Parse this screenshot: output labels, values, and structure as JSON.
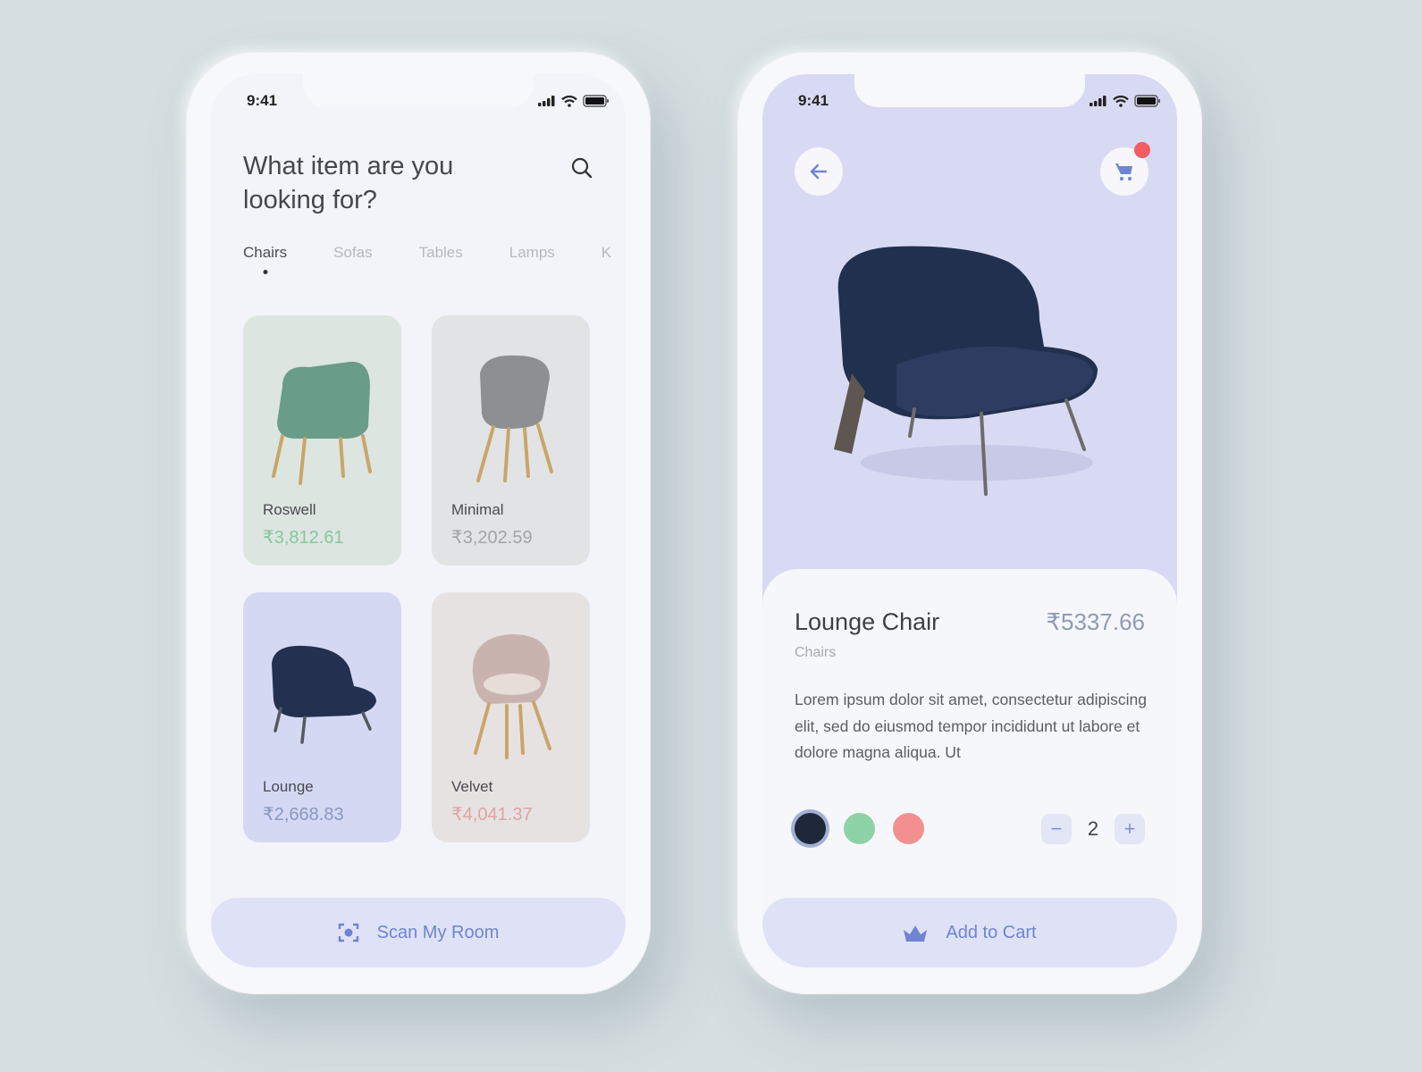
{
  "status_bar": {
    "time": "9:41"
  },
  "browse": {
    "headline": "What item are you looking for?",
    "search_icon": "search-icon",
    "tabs": [
      {
        "label": "Chairs",
        "active": true
      },
      {
        "label": "Sofas",
        "active": false
      },
      {
        "label": "Tables",
        "active": false
      },
      {
        "label": "Lamps",
        "active": false
      },
      {
        "label": "K",
        "active": false
      }
    ],
    "products": [
      {
        "name": "Roswell",
        "price": "₹3,812.61",
        "bg": "#dde5e1",
        "price_color": "#86c79c",
        "chair_color": "#6a9c8a"
      },
      {
        "name": "Minimal",
        "price": "₹3,202.59",
        "bg": "#e2e3e5",
        "price_color": "#a3a4a8",
        "chair_color": "#8e8f92"
      },
      {
        "name": "Lounge",
        "price": "₹2,668.83",
        "bg": "#d5d8f3",
        "price_color": "#8799c0",
        "chair_color": "#24304f"
      },
      {
        "name": "Velvet",
        "price": "₹4,041.37",
        "bg": "#e7e2e2",
        "price_color": "#e0a3a3",
        "chair_color": "#c9b3ae"
      }
    ],
    "cta_label": "Scan My Room",
    "cta_icon": "scan-icon"
  },
  "detail": {
    "back_icon": "arrow-left-icon",
    "cart_icon": "cart-icon",
    "title": "Lounge Chair",
    "price": "₹5337.66",
    "category": "Chairs",
    "description": "Lorem ipsum dolor sit amet, consectetur adipiscing elit, sed do eiusmod tempor incididunt ut labore et dolore magna aliqua. Ut",
    "colors": [
      {
        "hex": "#1f2838",
        "selected": true
      },
      {
        "hex": "#8ed3a5",
        "selected": false
      },
      {
        "hex": "#f48f8f",
        "selected": false
      }
    ],
    "quantity": "2",
    "minus_label": "−",
    "plus_label": "+",
    "cta_label": "Add to Cart",
    "cta_icon": "basket-icon"
  },
  "colors": {
    "accent": "#6f84d2",
    "hero_bg": "#d8daf3",
    "badge": "#f25c62"
  }
}
